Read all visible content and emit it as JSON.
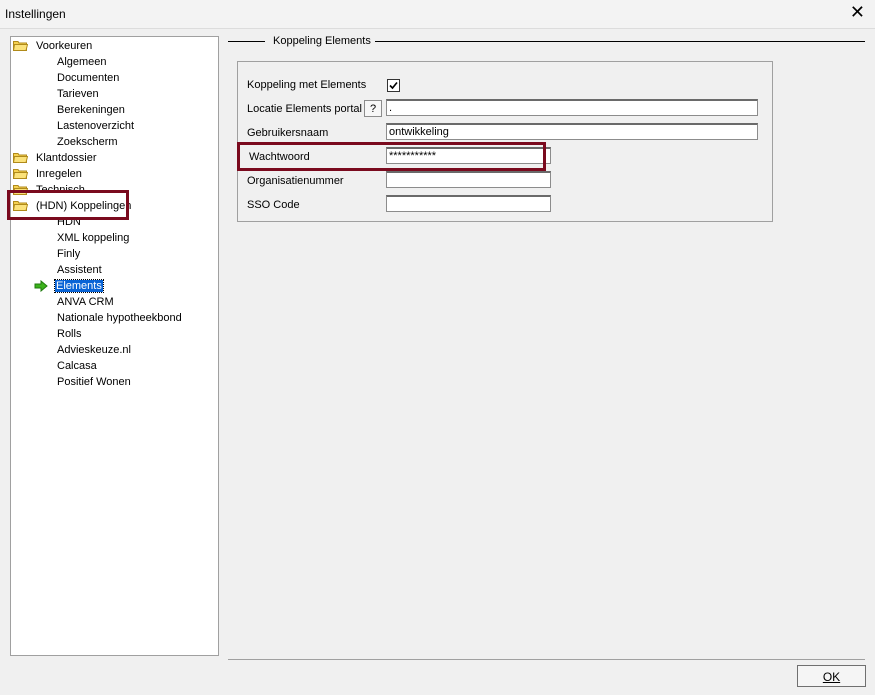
{
  "window": {
    "title": "Instellingen",
    "close_glyph": "✕"
  },
  "tree": {
    "top": [
      {
        "label": "Voorkeuren"
      },
      {
        "label": "Klantdossier"
      },
      {
        "label": "Inregelen"
      },
      {
        "label": "Technisch"
      },
      {
        "label": "(HDN) Koppelingen"
      }
    ],
    "voorkeuren_children": [
      "Algemeen",
      "Documenten",
      "Tarieven",
      "Berekeningen",
      "Lastenoverzicht",
      "Zoekscherm"
    ],
    "koppelingen_children": [
      "HDN",
      "XML koppeling",
      "Finly",
      "Assistent",
      "Elements",
      "ANVA CRM",
      "Nationale hypotheekbond",
      "Rolls",
      "Advieskeuze.nl",
      "Calcasa",
      "Positief Wonen"
    ],
    "selected": "Elements",
    "icons": {
      "folder": "folder-icon",
      "pointer": "arrow-right-icon"
    }
  },
  "section": {
    "title": "Koppeling Elements"
  },
  "form": {
    "koppeling_label": "Koppeling met Elements",
    "koppeling_checked": true,
    "locatie_label": "Locatie Elements portal",
    "locatie_help": "?",
    "locatie_value": ".",
    "gebruiker_label": "Gebruikersnaam",
    "gebruiker_value": "ontwikkeling",
    "wachtwoord_label": "Wachtwoord",
    "wachtwoord_value": "***********",
    "organisatie_label": "Organisatienummer",
    "organisatie_value": "",
    "sso_label": "SSO Code",
    "sso_value": ""
  },
  "footer": {
    "ok_label": "OK"
  },
  "colors": {
    "highlight": "#7a0a1e",
    "selection": "#0a64d6",
    "pointer": "#3cb21c"
  }
}
